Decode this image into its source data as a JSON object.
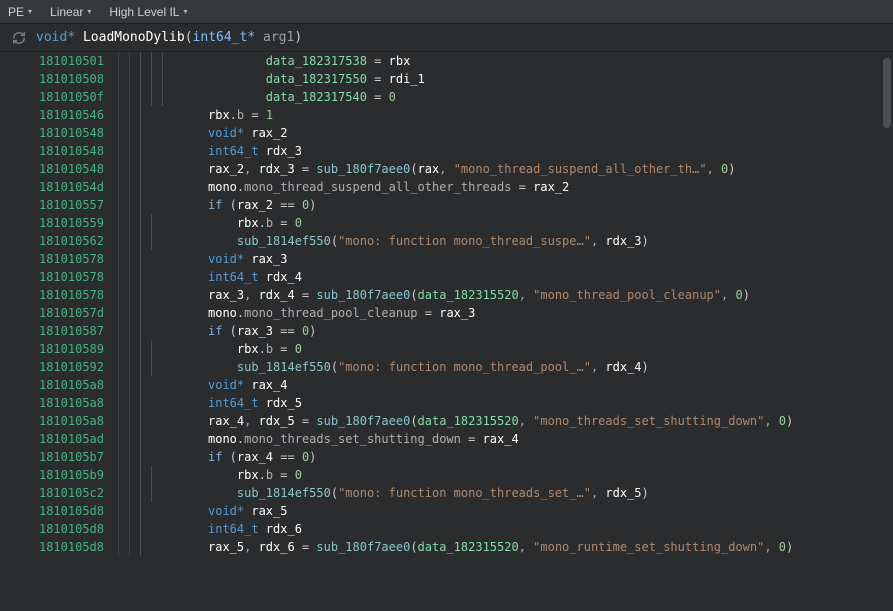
{
  "toolbar": {
    "items": [
      "PE",
      "Linear",
      "High Level IL"
    ]
  },
  "signature": {
    "ret_type": "void*",
    "name": "LoadMonoDylib",
    "param_type": "int64_t*",
    "param_name": "arg1"
  },
  "code": [
    {
      "addr": "181010501",
      "indent": 5,
      "tokens": [
        [
          "data",
          "data_182317538"
        ],
        [
          "op",
          " = "
        ],
        [
          "var",
          "rbx"
        ]
      ]
    },
    {
      "addr": "181010508",
      "indent": 5,
      "tokens": [
        [
          "data",
          "data_182317550"
        ],
        [
          "op",
          " = "
        ],
        [
          "var",
          "rdi_1"
        ]
      ]
    },
    {
      "addr": "18101050f",
      "indent": 5,
      "tokens": [
        [
          "data",
          "data_182317540"
        ],
        [
          "op",
          " = "
        ],
        [
          "num",
          "0"
        ]
      ]
    },
    {
      "addr": "181010546",
      "indent": 3,
      "tokens": [
        [
          "var",
          "rbx"
        ],
        [
          "op",
          "."
        ],
        [
          "field",
          "b"
        ],
        [
          "op",
          " = "
        ],
        [
          "num",
          "1"
        ]
      ]
    },
    {
      "addr": "181010548",
      "indent": 3,
      "tokens": [
        [
          "type",
          "void* "
        ],
        [
          "var",
          "rax_2"
        ]
      ]
    },
    {
      "addr": "181010548",
      "indent": 3,
      "tokens": [
        [
          "type",
          "int64_t "
        ],
        [
          "var",
          "rdx_3"
        ]
      ]
    },
    {
      "addr": "181010548",
      "indent": 3,
      "tokens": [
        [
          "var",
          "rax_2"
        ],
        [
          "comma",
          ", "
        ],
        [
          "var",
          "rdx_3"
        ],
        [
          "op",
          " = "
        ],
        [
          "func",
          "sub_180f7aee0"
        ],
        [
          "op",
          "("
        ],
        [
          "var",
          "rax"
        ],
        [
          "comma",
          ", "
        ],
        [
          "str",
          "\"mono_thread_suspend_all_other_th…\""
        ],
        [
          "comma",
          ", "
        ],
        [
          "num",
          "0"
        ],
        [
          "op",
          ")"
        ]
      ]
    },
    {
      "addr": "18101054d",
      "indent": 3,
      "tokens": [
        [
          "var",
          "mono"
        ],
        [
          "op",
          "."
        ],
        [
          "field",
          "mono_thread_suspend_all_other_threads"
        ],
        [
          "op",
          " = "
        ],
        [
          "var",
          "rax_2"
        ]
      ]
    },
    {
      "addr": "181010557",
      "indent": 3,
      "tokens": [
        [
          "kw",
          "if"
        ],
        [
          "op",
          " ("
        ],
        [
          "var",
          "rax_2"
        ],
        [
          "op",
          " == "
        ],
        [
          "num",
          "0"
        ],
        [
          "op",
          ")"
        ]
      ]
    },
    {
      "addr": "181010559",
      "indent": 4,
      "tokens": [
        [
          "var",
          "rbx"
        ],
        [
          "op",
          "."
        ],
        [
          "field",
          "b"
        ],
        [
          "op",
          " = "
        ],
        [
          "num",
          "0"
        ]
      ]
    },
    {
      "addr": "181010562",
      "indent": 4,
      "tokens": [
        [
          "func",
          "sub_1814ef550"
        ],
        [
          "op",
          "("
        ],
        [
          "str",
          "\"mono: function mono_thread_suspe…\""
        ],
        [
          "comma",
          ", "
        ],
        [
          "var",
          "rdx_3"
        ],
        [
          "op",
          ")"
        ]
      ]
    },
    {
      "addr": "181010578",
      "indent": 3,
      "tokens": [
        [
          "type",
          "void* "
        ],
        [
          "var",
          "rax_3"
        ]
      ]
    },
    {
      "addr": "181010578",
      "indent": 3,
      "tokens": [
        [
          "type",
          "int64_t "
        ],
        [
          "var",
          "rdx_4"
        ]
      ]
    },
    {
      "addr": "181010578",
      "indent": 3,
      "tokens": [
        [
          "var",
          "rax_3"
        ],
        [
          "comma",
          ", "
        ],
        [
          "var",
          "rdx_4"
        ],
        [
          "op",
          " = "
        ],
        [
          "func",
          "sub_180f7aee0"
        ],
        [
          "op",
          "("
        ],
        [
          "data",
          "data_182315520"
        ],
        [
          "comma",
          ", "
        ],
        [
          "str",
          "\"mono_thread_pool_cleanup\""
        ],
        [
          "comma",
          ", "
        ],
        [
          "num",
          "0"
        ],
        [
          "op",
          ")"
        ]
      ]
    },
    {
      "addr": "18101057d",
      "indent": 3,
      "tokens": [
        [
          "var",
          "mono"
        ],
        [
          "op",
          "."
        ],
        [
          "field",
          "mono_thread_pool_cleanup"
        ],
        [
          "op",
          " = "
        ],
        [
          "var",
          "rax_3"
        ]
      ]
    },
    {
      "addr": "181010587",
      "indent": 3,
      "tokens": [
        [
          "kw",
          "if"
        ],
        [
          "op",
          " ("
        ],
        [
          "var",
          "rax_3"
        ],
        [
          "op",
          " == "
        ],
        [
          "num",
          "0"
        ],
        [
          "op",
          ")"
        ]
      ]
    },
    {
      "addr": "181010589",
      "indent": 4,
      "tokens": [
        [
          "var",
          "rbx"
        ],
        [
          "op",
          "."
        ],
        [
          "field",
          "b"
        ],
        [
          "op",
          " = "
        ],
        [
          "num",
          "0"
        ]
      ]
    },
    {
      "addr": "181010592",
      "indent": 4,
      "tokens": [
        [
          "func",
          "sub_1814ef550"
        ],
        [
          "op",
          "("
        ],
        [
          "str",
          "\"mono: function mono_thread_pool_…\""
        ],
        [
          "comma",
          ", "
        ],
        [
          "var",
          "rdx_4"
        ],
        [
          "op",
          ")"
        ]
      ]
    },
    {
      "addr": "1810105a8",
      "indent": 3,
      "tokens": [
        [
          "type",
          "void* "
        ],
        [
          "var",
          "rax_4"
        ]
      ]
    },
    {
      "addr": "1810105a8",
      "indent": 3,
      "tokens": [
        [
          "type",
          "int64_t "
        ],
        [
          "var",
          "rdx_5"
        ]
      ]
    },
    {
      "addr": "1810105a8",
      "indent": 3,
      "tokens": [
        [
          "var",
          "rax_4"
        ],
        [
          "comma",
          ", "
        ],
        [
          "var",
          "rdx_5"
        ],
        [
          "op",
          " = "
        ],
        [
          "func",
          "sub_180f7aee0"
        ],
        [
          "op",
          "("
        ],
        [
          "data",
          "data_182315520"
        ],
        [
          "comma",
          ", "
        ],
        [
          "str",
          "\"mono_threads_set_shutting_down\""
        ],
        [
          "comma",
          ", "
        ],
        [
          "num",
          "0"
        ],
        [
          "op",
          ")"
        ]
      ]
    },
    {
      "addr": "1810105ad",
      "indent": 3,
      "tokens": [
        [
          "var",
          "mono"
        ],
        [
          "op",
          "."
        ],
        [
          "field",
          "mono_threads_set_shutting_down"
        ],
        [
          "op",
          " = "
        ],
        [
          "var",
          "rax_4"
        ]
      ]
    },
    {
      "addr": "1810105b7",
      "indent": 3,
      "tokens": [
        [
          "kw",
          "if"
        ],
        [
          "op",
          " ("
        ],
        [
          "var",
          "rax_4"
        ],
        [
          "op",
          " == "
        ],
        [
          "num",
          "0"
        ],
        [
          "op",
          ")"
        ]
      ]
    },
    {
      "addr": "1810105b9",
      "indent": 4,
      "tokens": [
        [
          "var",
          "rbx"
        ],
        [
          "op",
          "."
        ],
        [
          "field",
          "b"
        ],
        [
          "op",
          " = "
        ],
        [
          "num",
          "0"
        ]
      ]
    },
    {
      "addr": "1810105c2",
      "indent": 4,
      "tokens": [
        [
          "func",
          "sub_1814ef550"
        ],
        [
          "op",
          "("
        ],
        [
          "str",
          "\"mono: function mono_threads_set_…\""
        ],
        [
          "comma",
          ", "
        ],
        [
          "var",
          "rdx_5"
        ],
        [
          "op",
          ")"
        ]
      ]
    },
    {
      "addr": "1810105d8",
      "indent": 3,
      "tokens": [
        [
          "type",
          "void* "
        ],
        [
          "var",
          "rax_5"
        ]
      ]
    },
    {
      "addr": "1810105d8",
      "indent": 3,
      "tokens": [
        [
          "type",
          "int64_t "
        ],
        [
          "var",
          "rdx_6"
        ]
      ]
    },
    {
      "addr": "1810105d8",
      "indent": 3,
      "tokens": [
        [
          "var",
          "rax_5"
        ],
        [
          "comma",
          ", "
        ],
        [
          "var",
          "rdx_6"
        ],
        [
          "op",
          " = "
        ],
        [
          "func",
          "sub_180f7aee0"
        ],
        [
          "op",
          "("
        ],
        [
          "data",
          "data_182315520"
        ],
        [
          "comma",
          ", "
        ],
        [
          "str",
          "\"mono_runtime_set_shutting_down\""
        ],
        [
          "comma",
          ", "
        ],
        [
          "num",
          "0"
        ],
        [
          "op",
          ")"
        ]
      ]
    }
  ],
  "token_class_map": {
    "data": "t-data",
    "op": "t-op",
    "var": "t-def",
    "num": "t-num",
    "type": "t-type",
    "kw": "t-kw",
    "func": "t-func",
    "field": "t-field",
    "comma": "t-comma",
    "str": "t-str"
  }
}
